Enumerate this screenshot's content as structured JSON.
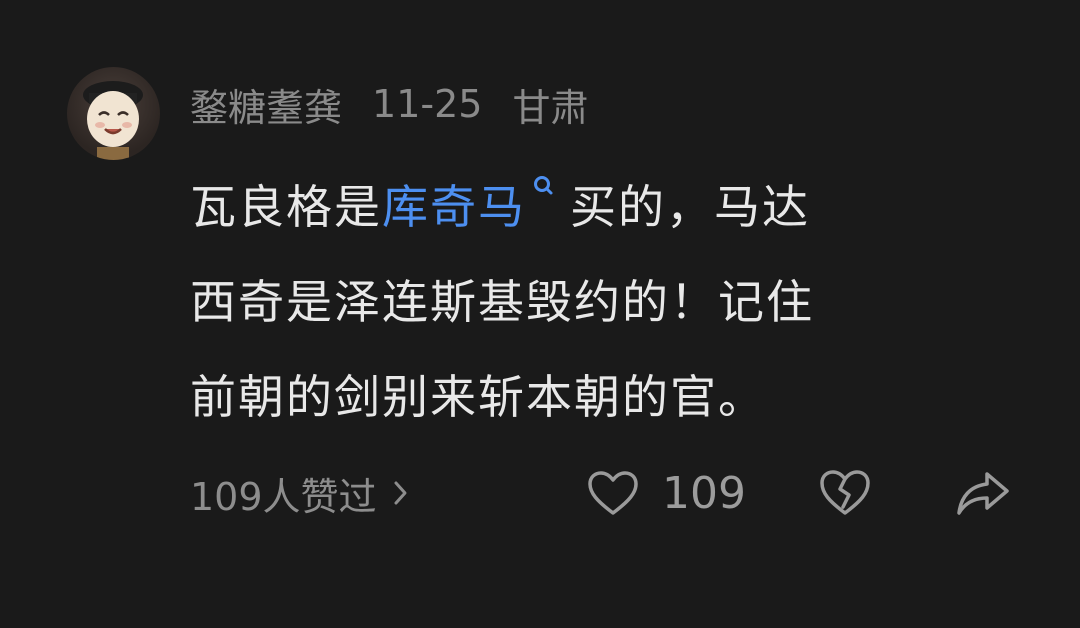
{
  "comment": {
    "username": "鍪糖耋龚",
    "date": "11-25",
    "location": "甘肃",
    "lines": [
      {
        "before": "瓦良格是",
        "link": "库奇马",
        "after": "买的，马达"
      },
      {
        "text": "西奇是泽连斯基毁约的！记住"
      },
      {
        "text": "前朝的剑别来斩本朝的官。"
      }
    ],
    "link_icon": "search-icon",
    "likes_summary": "109人赞过",
    "like_count": "109"
  },
  "icons": {
    "avatar": "cartoon-avatar",
    "chevron": "chevron-right-icon",
    "like": "heart-icon",
    "dislike": "broken-heart-icon",
    "share": "share-arrow-icon"
  },
  "colors": {
    "background": "#1a1a1a",
    "text": "#e8e8e8",
    "muted": "#8a8a8a",
    "link": "#4d8ff0"
  }
}
